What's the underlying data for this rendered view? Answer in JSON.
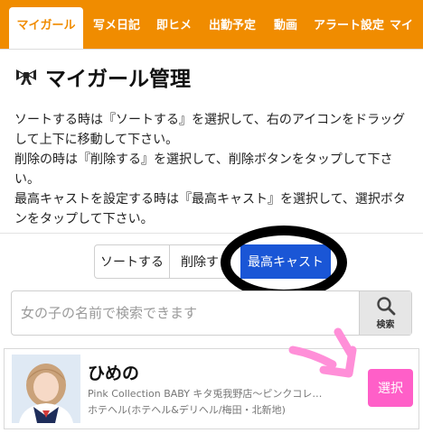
{
  "tabs": [
    {
      "label": "マイガール",
      "active": true
    },
    {
      "label": "写メ日記",
      "active": false
    },
    {
      "label": "即ヒメ",
      "active": false
    },
    {
      "label": "出勤予定",
      "active": false
    },
    {
      "label": "動画",
      "active": false
    },
    {
      "label": "アラート設定",
      "active": false
    },
    {
      "label": "マイ",
      "active": false
    }
  ],
  "page": {
    "title": "マイガール管理",
    "title_icon": "ribbon-icon",
    "instructions": [
      "ソートする時は『ソートする』を選択して、右のアイコンをドラッグして上下に移動して下さい。",
      "削除の時は『削除する』を選択して、削除ボタンをタップして下さい。",
      "最高キャストを設定する時は『最高キャスト』を選択して、選択ボタンをタップして下さい。"
    ]
  },
  "modes": {
    "sort_label": "ソートする",
    "delete_label": "削除す",
    "top_cast_label": "最高キャスト",
    "selected": "最高キャスト"
  },
  "search": {
    "placeholder": "女の子の名前で検索できます",
    "value": "",
    "button_label": "検索",
    "button_icon": "magnifier-icon"
  },
  "girls": [
    {
      "name": "ひめの",
      "shop": "Pink Collection BABY キタ兎我野店〜ピンクコレ…",
      "genre": "ホテヘル(ホテヘル&デリヘル/梅田・北新地)",
      "select_label": "選択"
    }
  ],
  "colors": {
    "tab_bar": "#f08c00",
    "primary_button": "#1a56d6",
    "select_button": "#ff5fc8",
    "annotation_arrow": "#ff8fd8",
    "annotation_ring": "#000000"
  }
}
